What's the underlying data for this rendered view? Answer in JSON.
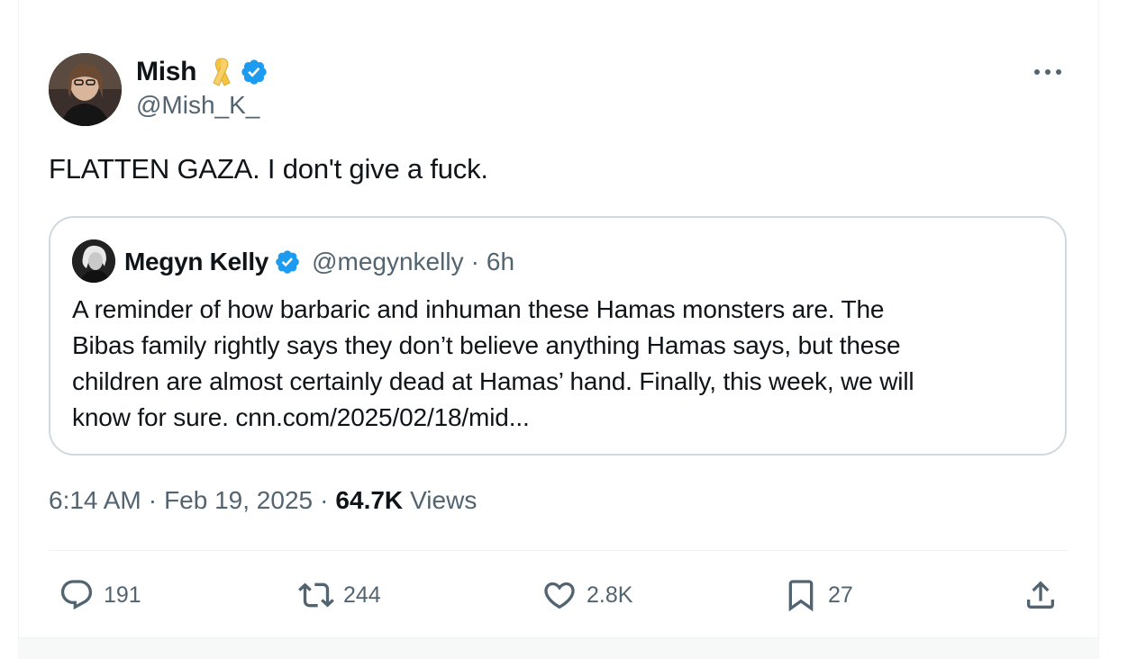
{
  "tweet": {
    "author": {
      "display_name": "Mish",
      "handle": "@Mish_K_",
      "ribbon_icon": "yellow-ribbon-icon",
      "verified_icon": "verified-badge-icon"
    },
    "text": "FLATTEN GAZA. I don't give a fuck.",
    "quote": {
      "author": {
        "display_name": "Megyn Kelly",
        "handle": "@megynkelly",
        "separator": "·",
        "time": "6h"
      },
      "lines": [
        "A reminder of how barbaric and inhuman these Hamas monsters are. The",
        "Bibas family rightly says they don’t believe anything Hamas says, but these",
        "children are almost certainly dead at Hamas’ hand. Finally, this week, we will",
        "know for sure. cnn.com/2025/02/18/mid..."
      ]
    },
    "meta": {
      "time": "6:14 AM",
      "separator": "·",
      "date": "Feb 19, 2025",
      "views_count": "64.7K",
      "views_label": "Views"
    },
    "actions": {
      "replies": "191",
      "reposts": "244",
      "likes": "2.8K",
      "bookmarks": "27"
    }
  },
  "colors": {
    "text_primary": "#0f1419",
    "text_secondary": "#536471",
    "verified_blue": "#1d9bf0",
    "ribbon_yellow": "#f5c542",
    "border": "#cfd9de"
  }
}
